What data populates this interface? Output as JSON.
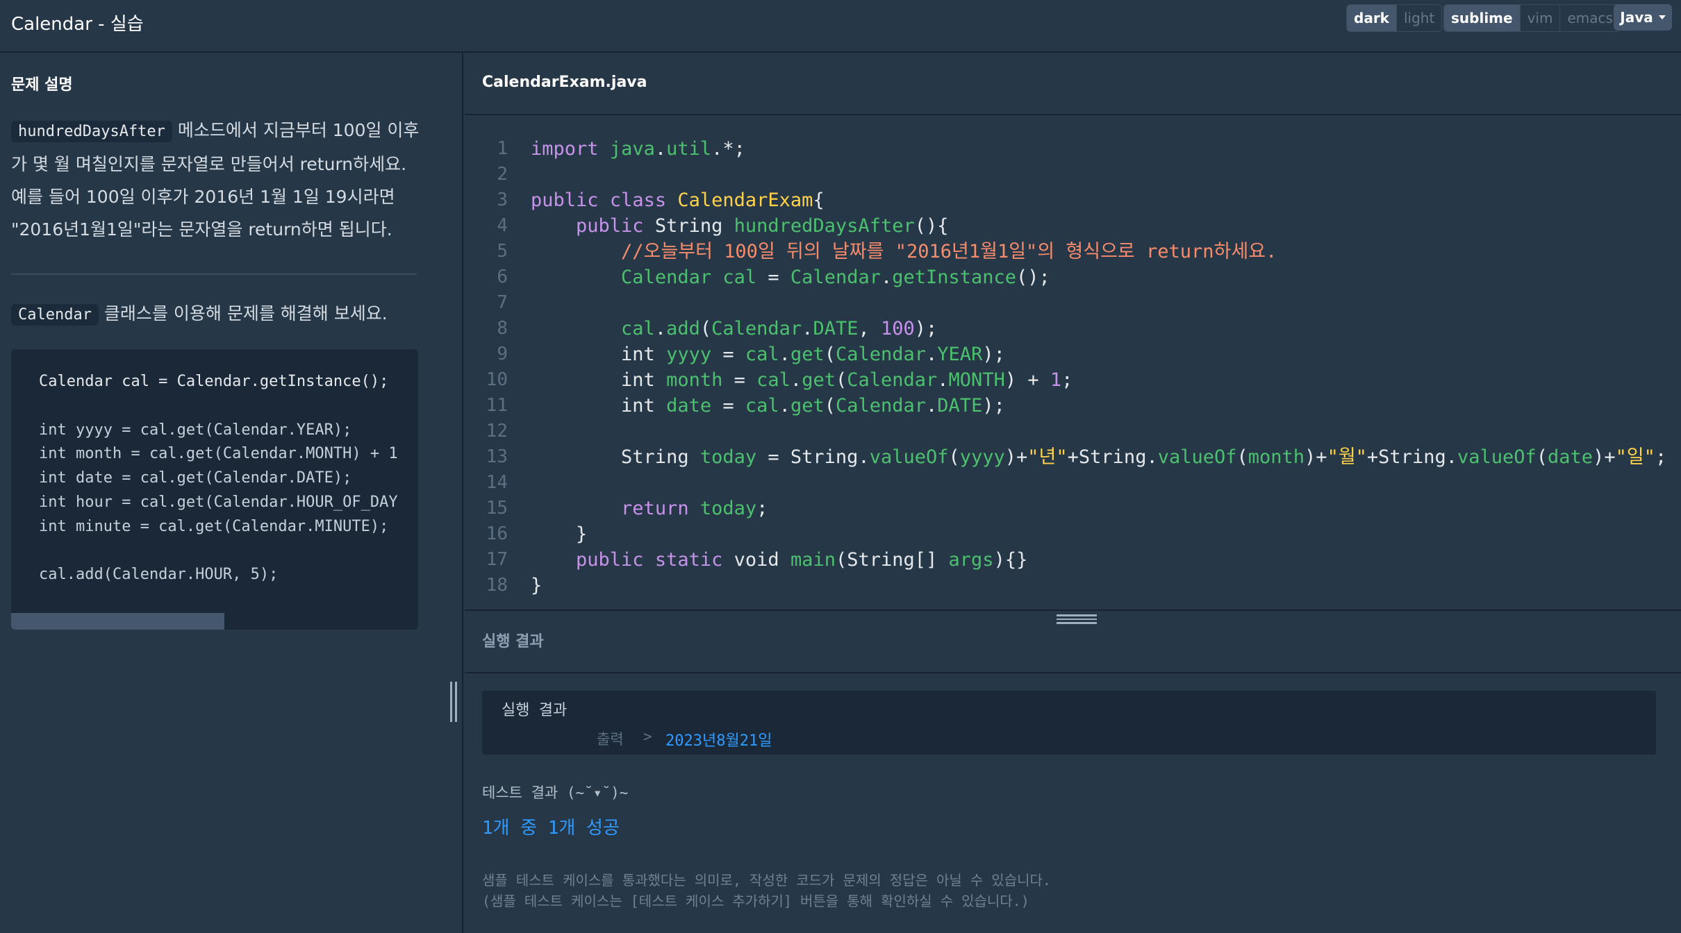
{
  "app": {
    "title": "Calendar - 실습"
  },
  "toolbar": {
    "theme_options": [
      "dark",
      "light"
    ],
    "editor_options": [
      "sublime",
      "vim",
      "emacs"
    ],
    "language": "Java"
  },
  "problem": {
    "heading": "문제 설명",
    "method_name": "hundredDaysAfter",
    "description": "메소드에서 지금부터 100일 이후가 몇 월 며칠인지를 문자열로 만들어서 return하세요. 예를 들어 100일 이후가 2016년 1월 1일 19시라면 \"2016년1월1일\"라는 문자열을 return하면 됩니다.",
    "class_name": "Calendar",
    "hint": "클래스를 이용해 문제를 해결해 보세요.",
    "example_code": [
      "Calendar cal = Calendar.getInstance();",
      "",
      "int yyyy = cal.get(Calendar.YEAR);",
      "int month = cal.get(Calendar.MONTH) + 1",
      "int date = cal.get(Calendar.DATE);",
      "int hour = cal.get(Calendar.HOUR_OF_DAY",
      "int minute = cal.get(Calendar.MINUTE);",
      "",
      "cal.add(Calendar.HOUR, 5);"
    ]
  },
  "editor": {
    "file_name": "CalendarExam.java",
    "line_numbers": [
      "1",
      "2",
      "3",
      "4",
      "5",
      "6",
      "7",
      "8",
      "9",
      "10",
      "11",
      "12",
      "13",
      "14",
      "15",
      "16",
      "17",
      "18"
    ]
  },
  "result": {
    "heading": "실행 결과",
    "box_title": "실행 결과",
    "output_label": "출력",
    "output_separator": ">",
    "output_value": "2023년8월21일",
    "test_title": "테스트 결과 (~˘▾˘)~",
    "test_summary": "1개 중 1개 성공",
    "note_line1": "샘플 테스트 케이스를 통과했다는 의미로, 작성한 코드가 문제의 정답은 아닐 수 있습니다.",
    "note_line2": "(샘플 테스트 케이스는 [테스트 케이스 추가하기] 버튼을 통해 확인하실 수 있습니다.)"
  },
  "colors": {
    "background": "#263747",
    "accent_blue": "#2f9bff",
    "keyword": "#c792ea",
    "class_name": "#ffd24a",
    "function": "#4cc06e",
    "comment": "#f78c6c"
  }
}
